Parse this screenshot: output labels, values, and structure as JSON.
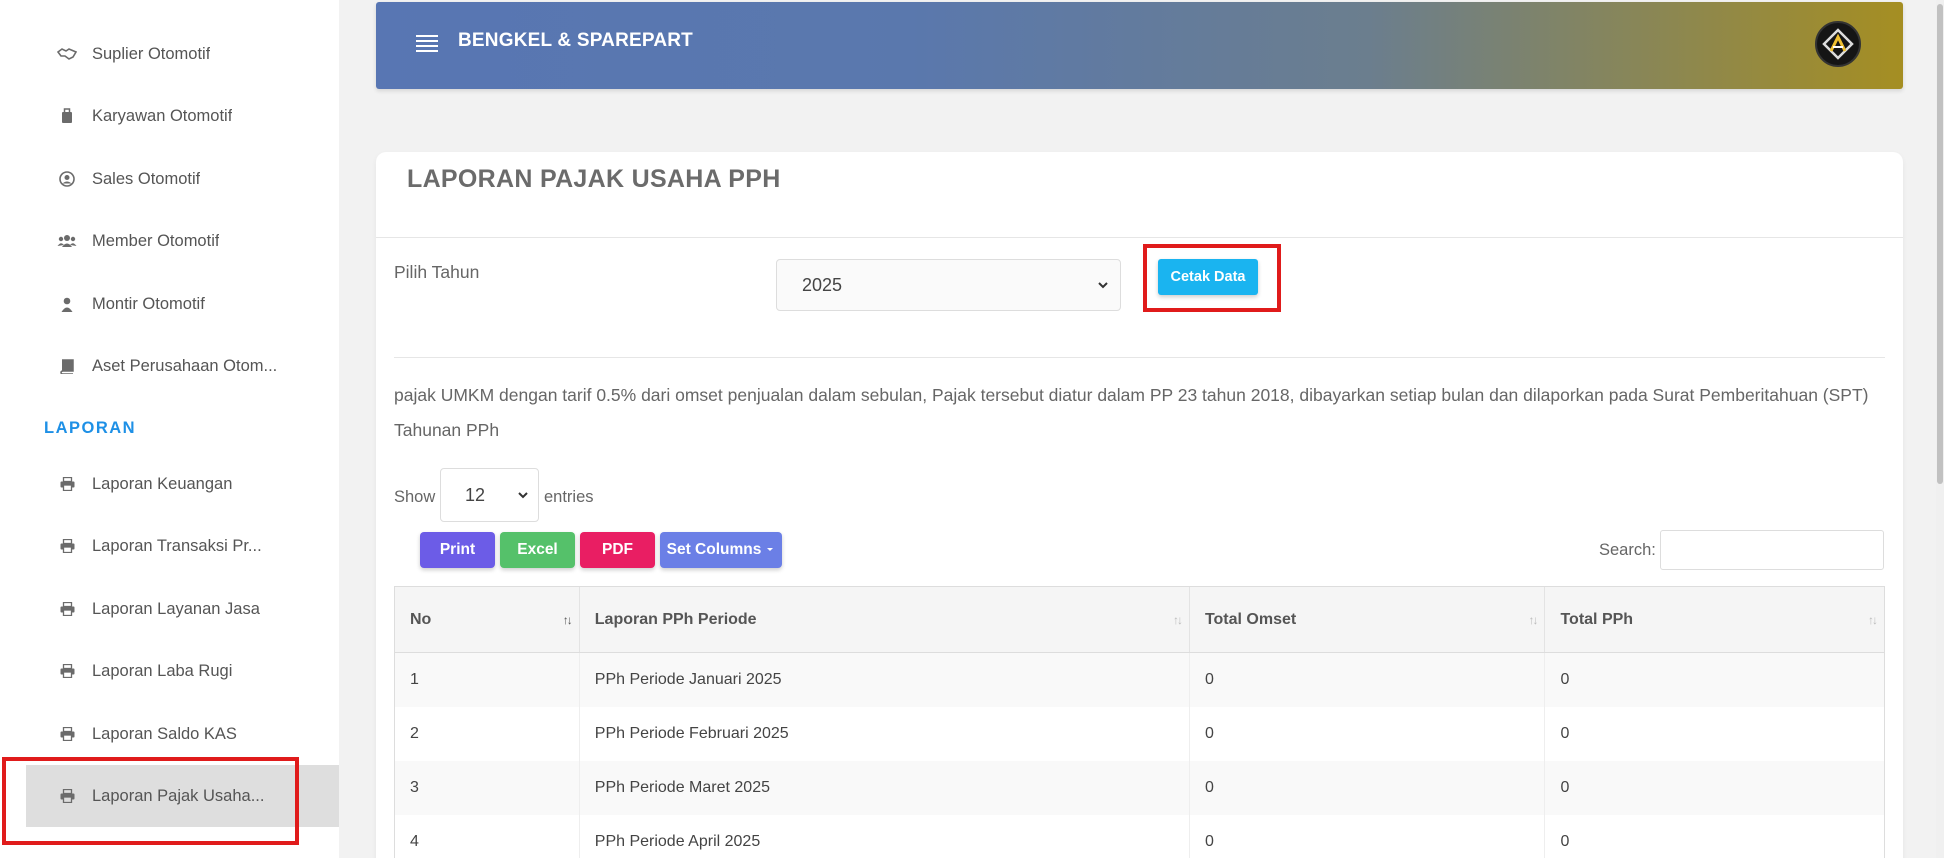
{
  "sidebar": {
    "items": [
      {
        "label": "Suplier Otomotif",
        "icon": "handshake-icon"
      },
      {
        "label": "Karyawan Otomotif",
        "icon": "briefcase-icon"
      },
      {
        "label": "Sales Otomotif",
        "icon": "user-circle-icon"
      },
      {
        "label": "Member Otomotif",
        "icon": "users-icon"
      },
      {
        "label": "Montir Otomotif",
        "icon": "user-icon"
      },
      {
        "label": "Aset Perusahaan Otom...",
        "icon": "book-icon"
      }
    ],
    "section_label": "LAPORAN",
    "report_items": [
      {
        "label": "Laporan Keuangan",
        "icon": "print-icon"
      },
      {
        "label": "Laporan Transaksi Pr...",
        "icon": "print-icon"
      },
      {
        "label": "Laporan Layanan Jasa",
        "icon": "print-icon"
      },
      {
        "label": "Laporan Laba Rugi",
        "icon": "print-icon"
      },
      {
        "label": "Laporan Saldo KAS",
        "icon": "print-icon"
      },
      {
        "label": "Laporan Pajak Usaha...",
        "icon": "print-icon",
        "active": true
      }
    ]
  },
  "header": {
    "brand": "BENGKEL & SPAREPART",
    "menu_icon": "hamburger-icon",
    "gradient_start": "#5876b3",
    "gradient_end": "#a58e22"
  },
  "page": {
    "title": "LAPORAN PAJAK USAHA PPH",
    "year_label": "Pilih Tahun",
    "year_value": "2025",
    "print_button": "Cetak Data",
    "description": "pajak UMKM dengan tarif 0.5% dari omset penjualan dalam sebulan, Pajak tersebut diatur dalam PP 23 tahun 2018, dibayarkan setiap bulan dan dilaporkan pada Surat Pemberitahuan (SPT) Tahunan PPh",
    "show_label": "Show",
    "entries_value": "12",
    "entries_label": "entries",
    "search_label": "Search:"
  },
  "toolbar": {
    "print": "Print",
    "excel": "Excel",
    "pdf": "PDF",
    "set_columns": "Set Columns"
  },
  "colors": {
    "print": "#6c5ce7",
    "excel": "#55c16a",
    "pdf": "#e91e63",
    "set_columns": "#6b7fe6",
    "cetak": "#1ab4f0",
    "highlight": "#e01b1b",
    "section": "#1e90e6"
  },
  "table": {
    "columns": [
      "No",
      "Laporan PPh Periode",
      "Total Omset",
      "Total PPh"
    ],
    "rows": [
      [
        "1",
        "PPh Periode Januari 2025",
        "0",
        "0"
      ],
      [
        "2",
        "PPh Periode Februari 2025",
        "0",
        "0"
      ],
      [
        "3",
        "PPh Periode Maret 2025",
        "0",
        "0"
      ],
      [
        "4",
        "PPh Periode April 2025",
        "0",
        "0"
      ]
    ]
  }
}
